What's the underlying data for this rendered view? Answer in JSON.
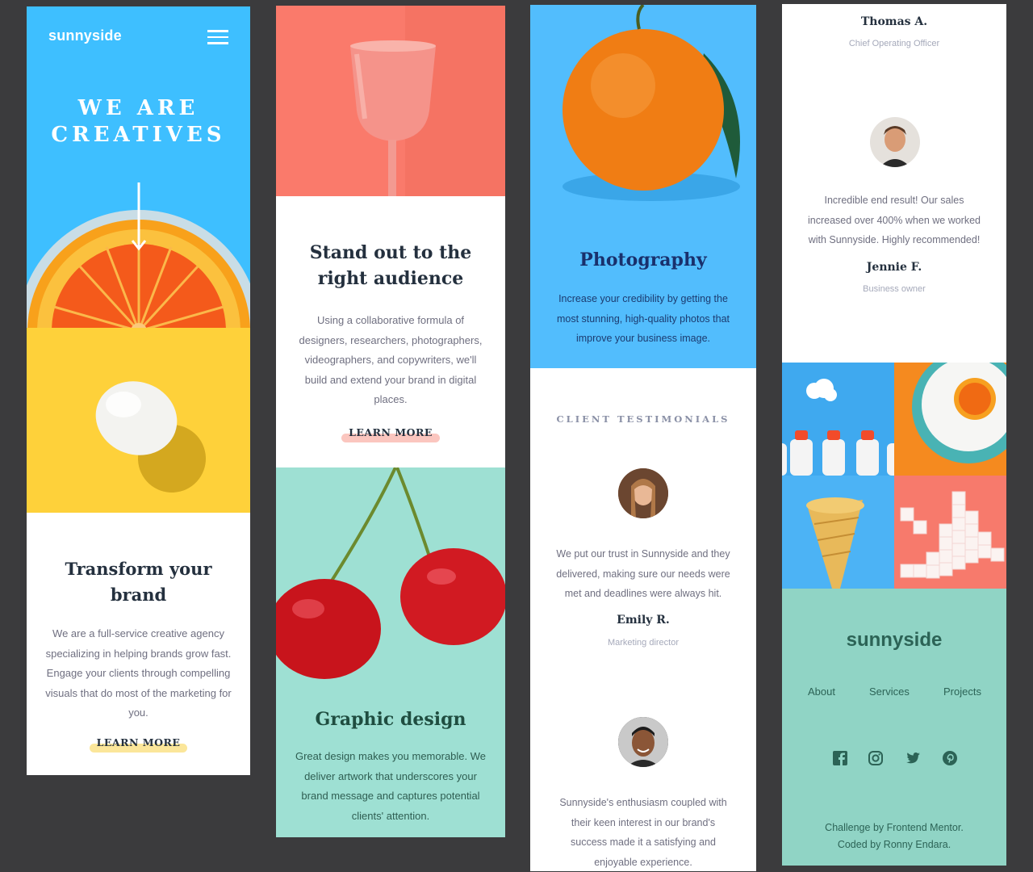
{
  "colors": {
    "page_bg": "#3b3b3d",
    "hero_blue": "#3ebfff",
    "yellow": "#fed13a",
    "coral": "#fa7a6b",
    "mint": "#9ee0d3",
    "photo_blue": "#52bdfd",
    "footer_green": "#90d4c5",
    "dark_text": "#24303e"
  },
  "header": {
    "logo": "sunnyside",
    "menu_icon": "hamburger-menu-icon"
  },
  "hero": {
    "title_line1": "WE ARE",
    "title_line2": "CREATIVES",
    "arrow_icon": "arrow-down-icon"
  },
  "transform": {
    "title_line1": "Transform your",
    "title_line2": "brand",
    "body": [
      "We are a full-service creative agency",
      "specializing in helping brands grow fast.",
      "Engage your clients through compelling",
      "visuals that do most of the marketing for",
      "you."
    ],
    "cta": "LEARN MORE"
  },
  "standout": {
    "title_line1": "Stand out to the",
    "title_line2": "right audience",
    "body": [
      "Using a collaborative formula of",
      "designers, researchers, photographers,",
      "videographers, and copywriters, we'll",
      "build and extend your brand in digital",
      "places."
    ],
    "cta": "LEARN MORE"
  },
  "graphic": {
    "title": "Graphic design",
    "body": [
      "Great design makes you memorable. We",
      "deliver artwork that underscores your",
      "brand message and captures potential",
      "clients' attention."
    ]
  },
  "photography": {
    "title": "Photography",
    "body": [
      "Increase your credibility by getting the",
      "most stunning, high-quality photos that",
      "improve your business image."
    ]
  },
  "testimonials": {
    "label": "CLIENT TESTIMONIALS",
    "items": [
      {
        "quote": [
          "We put our trust in Sunnyside and they",
          "delivered, making sure our needs were",
          "met and deadlines were always hit."
        ],
        "name": "Emily R.",
        "role": "Marketing director"
      },
      {
        "quote": [
          "Sunnyside's enthusiasm coupled with",
          "their keen interest in our brand's",
          "success made it a satisfying and",
          "enjoyable experience."
        ],
        "name": "Thomas A.",
        "role": "Chief Operating Officer"
      },
      {
        "quote": [
          "Incredible end result! Our sales",
          "increased over 400% when we worked",
          "with Sunnyside. Highly recommended!"
        ],
        "name": "Jennie F.",
        "role": "Business owner"
      }
    ]
  },
  "footer": {
    "logo": "sunnyside",
    "nav": [
      "About",
      "Services",
      "Projects"
    ],
    "social_icons": [
      "facebook-icon",
      "instagram-icon",
      "twitter-icon",
      "pinterest-icon"
    ],
    "credit_line1": "Challenge by Frontend Mentor.",
    "credit_line2": "Coded by Ronny Endara."
  }
}
